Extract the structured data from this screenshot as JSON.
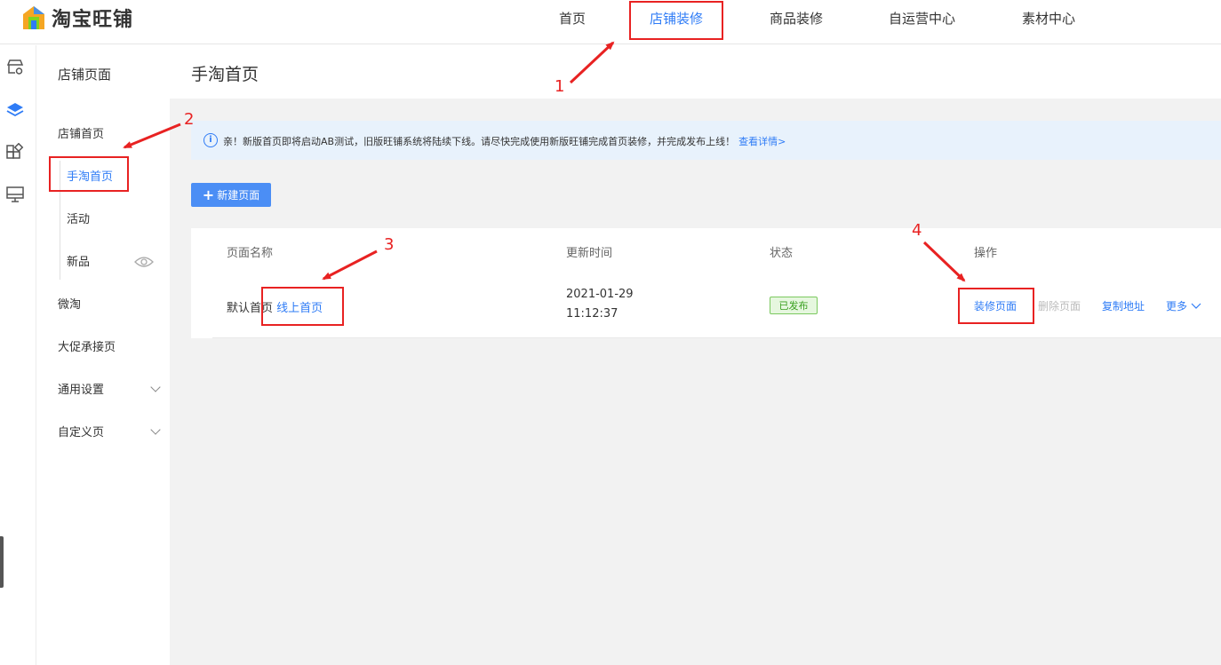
{
  "header": {
    "logo_text": "淘宝旺铺",
    "nav": [
      {
        "label": "首页"
      },
      {
        "label": "店铺装修"
      },
      {
        "label": "商品装修"
      },
      {
        "label": "自运营中心"
      },
      {
        "label": "素材中心"
      }
    ],
    "active_nav": "店铺装修"
  },
  "rail": {
    "icons": [
      "store-settings-icon",
      "layers-icon",
      "modules-icon",
      "monitor-icon"
    ]
  },
  "sidebar": {
    "title": "店铺页面",
    "items": [
      {
        "label": "店铺首页"
      },
      {
        "label": "手淘首页"
      },
      {
        "label": "活动"
      },
      {
        "label": "新品"
      },
      {
        "label": "微淘"
      },
      {
        "label": "大促承接页"
      },
      {
        "label": "通用设置"
      },
      {
        "label": "自定义页"
      }
    ],
    "active_item": "手淘首页"
  },
  "main": {
    "title": "手淘首页",
    "notice": {
      "text": "亲！新版首页即将启动AB测试，旧版旺铺系统将陆续下线。请尽快完成使用新版旺铺完成首页装修，并完成发布上线！",
      "link": "查看详情>"
    },
    "new_button": "新建页面",
    "table": {
      "columns": [
        "页面名称",
        "更新时间",
        "状态",
        "操作"
      ],
      "rows": [
        {
          "name": "默认首页",
          "tag": "线上首页",
          "date": "2021-01-29",
          "time": "11:12:37",
          "status": "已发布",
          "actions": [
            "装修页面",
            "删除页面",
            "复制地址",
            "更多"
          ]
        }
      ]
    }
  },
  "annotations": [
    "1",
    "2",
    "3",
    "4"
  ],
  "colors": {
    "accent": "#2f7cf6",
    "annotation": "#e82222",
    "status_green": "#3aa020"
  }
}
